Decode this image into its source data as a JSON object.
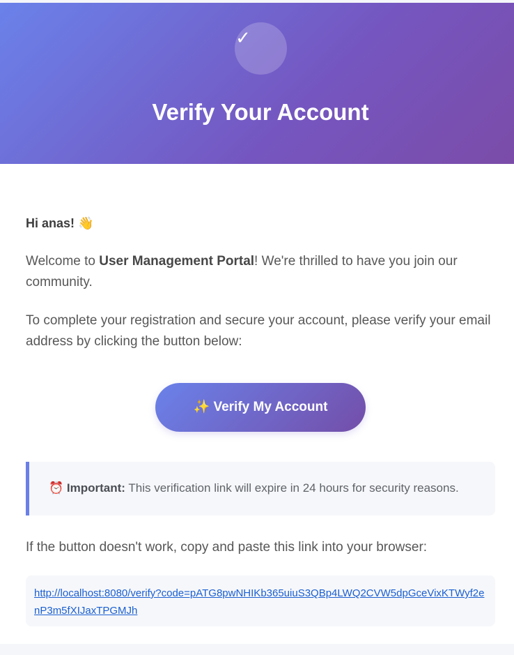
{
  "header": {
    "check_glyph": "✓",
    "title": "Verify Your Account"
  },
  "body": {
    "greeting": "Hi anas! 👋",
    "welcome_prefix": "Welcome to ",
    "portal_name": "User Management Portal",
    "welcome_suffix": "! We're thrilled to have you join our community.",
    "instructions": "To complete your registration and secure your account, please verify your email address by clicking the button below:",
    "verify_button_label": "✨ Verify My Account",
    "notice": {
      "icon_glyph": "⏰",
      "label": "Important:",
      "text": " This verification link will expire in 24 hours for security reasons."
    },
    "fallback_text": "If the button doesn't work, copy and paste this link into your browser:",
    "verification_link": "http://localhost:8080/verify?code=pATG8pwNHIKb365uiuS3QBp4LWQ2CVW5dpGceVixKTWyf2enP3m5fXIJaxTPGMJh"
  },
  "colors": {
    "header_gradient_start": "#6a82ea",
    "header_gradient_end": "#7b4ca8",
    "notice_border": "#6a7fe8",
    "link": "#1a5fd1"
  }
}
